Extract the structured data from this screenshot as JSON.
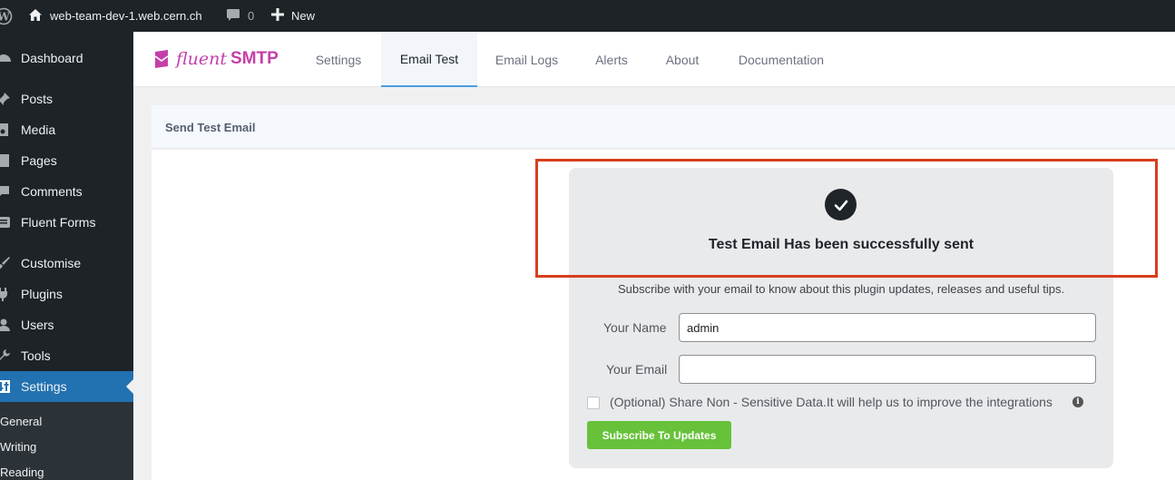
{
  "adminbar": {
    "site_name": "web-team-dev-1.web.cern.ch",
    "comments_count": "0",
    "new_label": "New"
  },
  "sidebar": {
    "items": [
      {
        "label": "Dashboard",
        "icon": "dashboard-icon"
      },
      {
        "label": "Posts",
        "icon": "pin-icon"
      },
      {
        "label": "Media",
        "icon": "media-icon"
      },
      {
        "label": "Pages",
        "icon": "page-icon"
      },
      {
        "label": "Comments",
        "icon": "comment-icon"
      },
      {
        "label": "Fluent Forms",
        "icon": "forms-icon"
      },
      {
        "label": "Customise",
        "icon": "brush-icon"
      },
      {
        "label": "Plugins",
        "icon": "plugin-icon"
      },
      {
        "label": "Users",
        "icon": "users-icon"
      },
      {
        "label": "Tools",
        "icon": "wrench-icon"
      },
      {
        "label": "Settings",
        "icon": "settings-icon",
        "active": true
      }
    ],
    "submenu": [
      "General",
      "Writing",
      "Reading"
    ]
  },
  "plugin": {
    "logo_part1": "fluent",
    "logo_part2": "SMTP",
    "tabs": [
      {
        "label": "Settings"
      },
      {
        "label": "Email Test",
        "active": true
      },
      {
        "label": "Email Logs"
      },
      {
        "label": "Alerts"
      },
      {
        "label": "About"
      },
      {
        "label": "Documentation"
      }
    ]
  },
  "card": {
    "header": "Send Test Email",
    "success_message": "Test Email Has been successfully sent",
    "subscribe_text": "Subscribe with your email to know about this plugin updates, releases and useful tips.",
    "name_label": "Your Name",
    "name_value": "admin",
    "email_label": "Your Email",
    "email_value": "",
    "optional_text": "(Optional) Share Non - Sensitive Data.It will help us to improve the integrations",
    "subscribe_button": "Subscribe To Updates"
  },
  "colors": {
    "accent": "#2271b1",
    "brand": "#c53fa9",
    "highlight": "#d63e1f",
    "success_button": "#67c23a"
  }
}
